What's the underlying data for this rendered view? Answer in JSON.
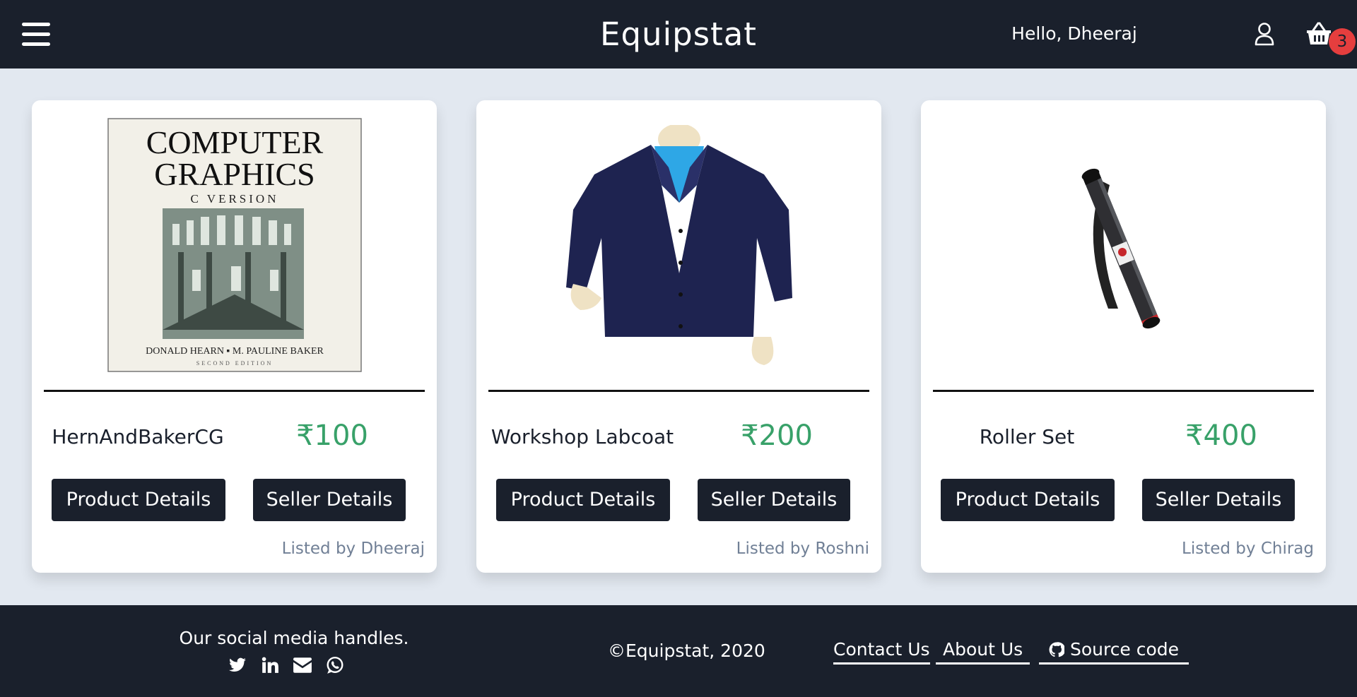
{
  "header": {
    "brand": "Equipstat",
    "greeting": "Hello, Dheeraj",
    "cart_count": "3",
    "icons": [
      "menu-icon",
      "user-icon",
      "basket-icon"
    ]
  },
  "products": [
    {
      "name": "HernAndBakerCG",
      "price": "₹100",
      "product_button": "Product Details",
      "seller_button": "Seller Details",
      "listed_by": "Listed by Dheeraj",
      "image": {
        "title_line1": "COMPUTER",
        "title_line2": "GRAPHICS",
        "subtitle": "C VERSION",
        "authors": "DONALD HEARN ▪ M. PAULINE BAKER",
        "edition": "SECOND EDITION"
      }
    },
    {
      "name": "Workshop Labcoat",
      "price": "₹200",
      "product_button": "Product Details",
      "seller_button": "Seller Details",
      "listed_by": "Listed by Roshni"
    },
    {
      "name": "Roller Set",
      "price": "₹400",
      "product_button": "Product Details",
      "seller_button": "Seller Details",
      "listed_by": "Listed by Chirag"
    }
  ],
  "footer": {
    "social_title": "Our social media handles.",
    "social_icons": [
      "twitter-icon",
      "linkedin-icon",
      "email-icon",
      "whatsapp-icon"
    ],
    "copyright": "©Equipstat, 2020",
    "links": {
      "contact": "Contact Us",
      "about": "About Us",
      "source": "Source code"
    }
  },
  "colors": {
    "header_bg": "#1a202c",
    "page_bg": "#e2e8f0",
    "price": "#38a169",
    "badge": "#e53e3e",
    "muted": "#718096"
  }
}
